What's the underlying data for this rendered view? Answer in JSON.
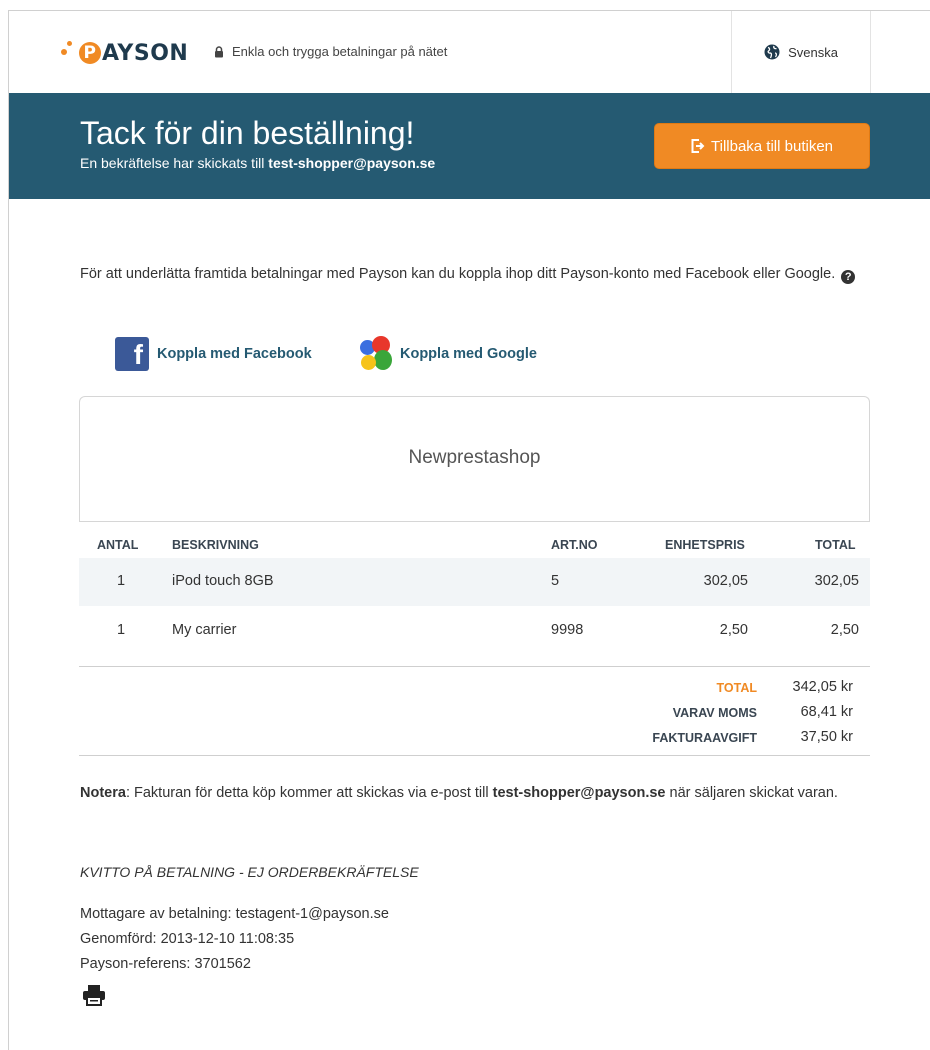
{
  "header": {
    "logo_text": "AYSON",
    "logo_letter": "P",
    "tagline": "Enkla och trygga betalningar på nätet",
    "language": "Svenska"
  },
  "banner": {
    "title": "Tack för din beställning!",
    "subtitle_prefix": "En bekräftelse har skickats till ",
    "email": "test-shopper@payson.se",
    "back_button": "Tillbaka till butiken"
  },
  "connect": {
    "intro": "För att underlätta framtida betalningar med Payson kan du koppla ihop ditt Payson-konto med Facebook eller Google.",
    "help": "?",
    "facebook_label": "Koppla med Facebook",
    "google_label": "Koppla med Google"
  },
  "shop": {
    "name": "Newprestashop"
  },
  "table": {
    "headers": {
      "qty": "ANTAL",
      "desc": "BESKRIVNING",
      "artno": "ART.NO",
      "unit": "ENHETSPRIS",
      "total": "TOTAL"
    },
    "rows": [
      {
        "qty": "1",
        "desc": "iPod touch 8GB",
        "artno": "5",
        "unit": "302,05",
        "total": "302,05"
      },
      {
        "qty": "1",
        "desc": "My carrier",
        "artno": "9998",
        "unit": "2,50",
        "total": "2,50"
      }
    ]
  },
  "totals": {
    "total_label": "TOTAL",
    "total_value": "342,05 kr",
    "vat_label": "VARAV MOMS",
    "vat_value": "68,41 kr",
    "fee_label": "FAKTURAAVGIFT",
    "fee_value": "37,50 kr"
  },
  "note": {
    "label": "Notera",
    "text_before": ": Fakturan för detta köp kommer att skickas via e-post till ",
    "email": "test-shopper@payson.se",
    "text_after": " när säljaren skickat varan."
  },
  "receipt": {
    "title": "KVITTO PÅ BETALNING - EJ ORDERBEKRÄFTELSE",
    "recipient": "Mottagare av betalning: testagent-1@payson.se",
    "completed": "Genomförd: 2013-12-10 11:08:35",
    "reference": "Payson-referens: 3701562"
  },
  "colors": {
    "banner": "#255a72",
    "accent": "#f08a24",
    "facebook": "#3b5998"
  },
  "icons": {
    "lock": "lock-icon",
    "globe": "globe-icon",
    "exit": "exit-icon",
    "help": "help-icon",
    "facebook": "facebook-icon",
    "google": "google-icon",
    "print": "print-icon"
  }
}
